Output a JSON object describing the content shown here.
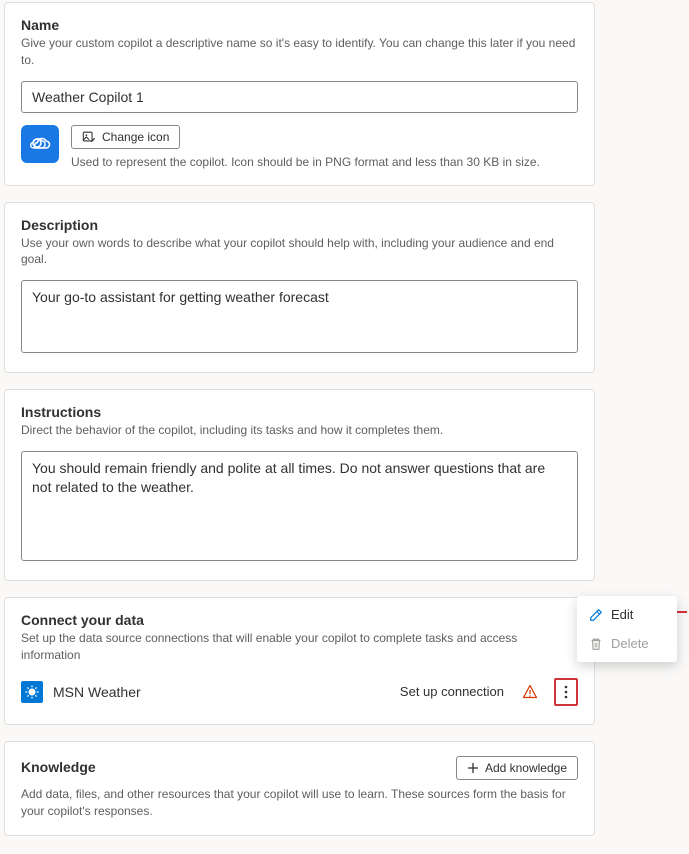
{
  "name_section": {
    "title": "Name",
    "helper": "Give your custom copilot a descriptive name so it's easy to identify. You can change this later if you need to.",
    "value": "Weather Copilot 1",
    "change_icon_label": "Change icon",
    "icon_helper": "Used to represent the copilot. Icon should be in PNG format and less than 30 KB in size."
  },
  "description_section": {
    "title": "Description",
    "helper": "Use your own words to describe what your copilot should help with, including your audience and end goal.",
    "value": "Your go-to assistant for getting weather forecast"
  },
  "instructions_section": {
    "title": "Instructions",
    "helper": "Direct the behavior of the copilot, including its tasks and how it completes them.",
    "value": "You should remain friendly and polite at all times. Do not answer questions that are not related to the weather."
  },
  "connect_section": {
    "title": "Connect your data",
    "helper": "Set up the data source connections that will enable your copilot to complete tasks and access information",
    "source_name": "MSN Weather",
    "setup_label": "Set up connection"
  },
  "knowledge_section": {
    "title": "Knowledge",
    "add_label": "Add knowledge",
    "helper": "Add data, files, and other resources that your copilot will use to learn. These sources form the basis for your copilot's responses."
  },
  "menu": {
    "edit": "Edit",
    "delete": "Delete"
  }
}
